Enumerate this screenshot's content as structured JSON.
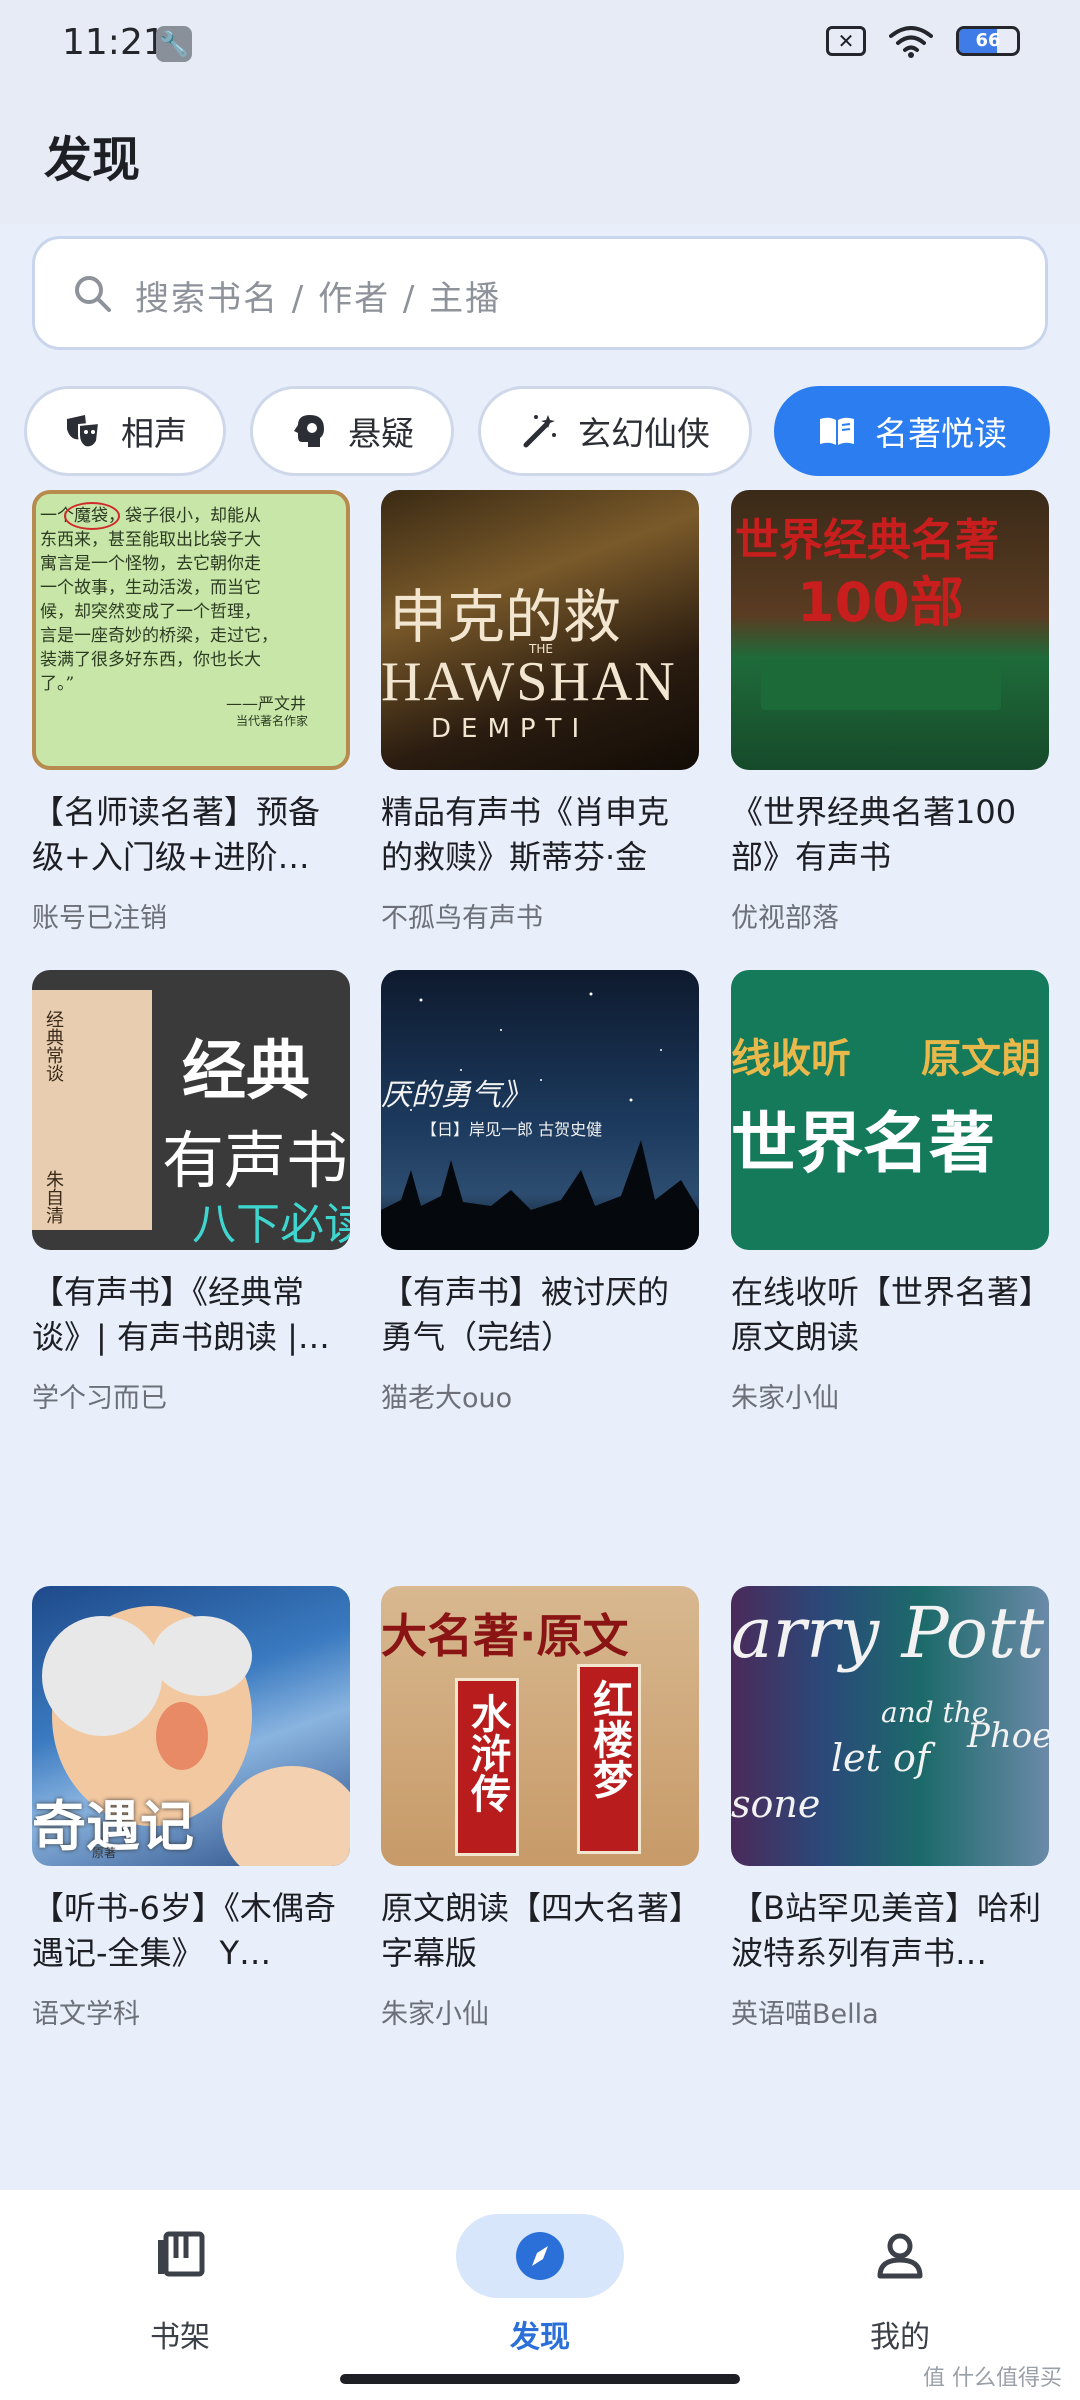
{
  "status": {
    "time": "11:21",
    "battery_level": 66,
    "battery_text": "66"
  },
  "header": {
    "title": "发现"
  },
  "search": {
    "placeholder": "搜索书名 / 作者 / 主播"
  },
  "chips": [
    {
      "label": "相声",
      "icon": "comedy-mask-icon",
      "active": false
    },
    {
      "label": "悬疑",
      "icon": "brain-icon",
      "active": false
    },
    {
      "label": "玄幻仙侠",
      "icon": "magic-wand-icon",
      "active": false
    },
    {
      "label": "名著悦读",
      "icon": "open-book-icon",
      "active": true
    }
  ],
  "books": [
    {
      "title": "【名师读名著】预备级+入门级+进阶…",
      "author": "账号已注销",
      "cover_text": [
        "一个魔袋，袋子很小，却能从",
        "东西来，甚至能取出比袋子大",
        "寓言是一个怪物，去它朝你走",
        "一个故事，生动活泼，而当它",
        "候，却突然变成了一个哲理，",
        "言是一座奇妙的桥梁，走过它，",
        "装满了很多好东西，你也长大",
        "了。”",
        "——严文井",
        "当代著名作家"
      ]
    },
    {
      "title": "精品有声书《肖申克的救赎》斯蒂芬·金",
      "author": "不孤鸟有声书",
      "cover_text": [
        "申克的救",
        "THE",
        "HAWSHAN",
        "DEMPTI"
      ]
    },
    {
      "title": "《世界经典名著100部》有声书",
      "author": "优视部落",
      "cover_text": [
        "世界经典名著",
        "100部"
      ]
    },
    {
      "title": "【有声书】《经典常谈》| 有声书朗读 |…",
      "author": "学个习而已",
      "cover_text": [
        "经典",
        "有声书",
        "八下必读",
        "经典常谈",
        "朱自清"
      ]
    },
    {
      "title": "【有声书】被讨厌的勇气（完结）",
      "author": "猫老大ouo",
      "cover_text": [
        "厌的勇气》",
        "【日】岸见一郎  古贺史健"
      ]
    },
    {
      "title": "在线收听【世界名著】原文朗读",
      "author": "朱家小仙",
      "cover_text": [
        "线收听",
        "原文朗",
        "世界名著"
      ]
    },
    {
      "title": "【听书-6岁】《木偶奇遇记-全集》　Y…",
      "author": "语文学科",
      "cover_text": [
        "奇遇记",
        "原著"
      ]
    },
    {
      "title": "原文朗读【四大名著】字幕版",
      "author": "朱家小仙",
      "cover_text": [
        "大名著·原文",
        "水浒传",
        "红楼梦"
      ]
    },
    {
      "title": "【B站罕见美音】哈利波特系列有声书…",
      "author": "英语喵Bella",
      "cover_text": [
        "arry Pott",
        "and the",
        "let of",
        "Phoe",
        "sone"
      ]
    }
  ],
  "nav": [
    {
      "label": "书架",
      "icon": "bookshelf-icon",
      "active": false
    },
    {
      "label": "发现",
      "icon": "compass-icon",
      "active": true
    },
    {
      "label": "我的",
      "icon": "person-icon",
      "active": false
    }
  ],
  "watermark": "值 什么值得买",
  "colors": {
    "accent": "#2b7df0",
    "background": "#e8effa"
  }
}
